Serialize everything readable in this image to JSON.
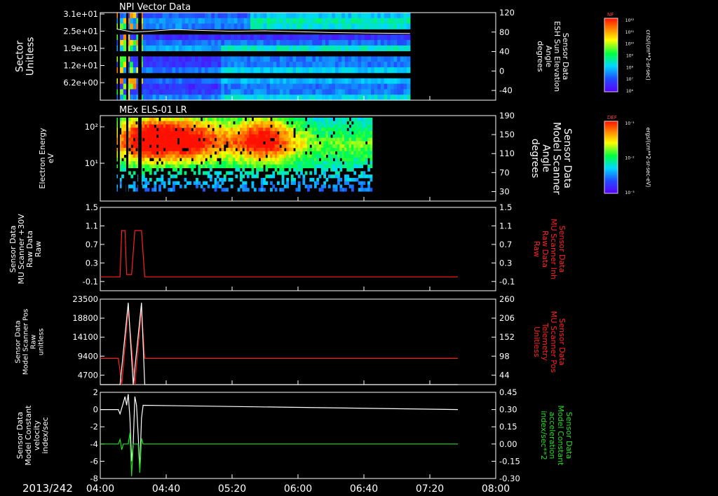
{
  "date_label": "2013/242",
  "time_ticks": [
    "04:00",
    "04:40",
    "05:20",
    "06:00",
    "06:40",
    "07:20",
    "08:00"
  ],
  "colors": {
    "background": "#000000",
    "axis": "#ffffff",
    "trace_red": "#ff2020",
    "trace_green": "#22dd22",
    "trace_white": "#ffffff",
    "right_label_red": "#ff2020",
    "right_label_green": "#22dd22"
  },
  "chart_data": [
    {
      "type": "heatmap",
      "title": "NPI Vector Data",
      "x_range": [
        "04:00",
        "08:00"
      ],
      "y_label_lines": [
        "Sector",
        "Unitless"
      ],
      "y_ticks": [
        "3.1e+01",
        "2.5e+01",
        "1.9e+01",
        "1.2e+01",
        "6.2e+00"
      ],
      "right_ticks": [
        "120",
        "80",
        "40",
        "0",
        "-40"
      ],
      "right_range": [
        -80,
        120
      ],
      "right_label_lines": [
        "Sensor Data",
        "ESH Sun Elevation",
        "Angle",
        "degrees"
      ],
      "colorbar": {
        "label": "NF",
        "units": "cnts/(cm**2-sr-sec)",
        "ticks": [
          "10¹²",
          "10¹¹",
          "10¹⁰",
          "10⁹",
          "10⁸",
          "10⁷",
          "10⁶"
        ]
      },
      "data_extent": [
        "04:10",
        "07:08"
      ],
      "overlay_line": {
        "name": "ESH Sun Elevation Angle",
        "x": [
          "04:10",
          "04:20",
          "04:30",
          "04:45",
          "05:00",
          "05:20",
          "05:40",
          "06:00",
          "06:20",
          "06:40",
          "07:08"
        ],
        "y": [
          85,
          78,
          80,
          84,
          82,
          80,
          81,
          79,
          77,
          76,
          75
        ]
      }
    },
    {
      "type": "heatmap",
      "title": "MEx ELS-01 LR",
      "x_range": [
        "04:00",
        "08:00"
      ],
      "y_label_lines": [
        "Electron Energy",
        "eV"
      ],
      "y_ticks": [
        "10²",
        "10¹"
      ],
      "y_scale": "log",
      "right_ticks": [
        "190",
        "150",
        "110",
        "70",
        "30"
      ],
      "right_range": [
        0,
        190
      ],
      "right_label_lines": [
        "Sensor Data",
        "Model Scanner",
        "Angle",
        "degrees"
      ],
      "colorbar": {
        "label": "DEF",
        "units": "ergs/(cm**2-sr-sec-eV)",
        "ticks": [
          "10⁻¹",
          "10⁻²",
          "10⁻³"
        ]
      },
      "data_extent": [
        "04:10",
        "06:45"
      ]
    },
    {
      "type": "line",
      "x_range": [
        "04:00",
        "08:00"
      ],
      "y_label_lines": [
        "Sensor Data",
        "MU Scanner +30V",
        "Raw Data",
        "Raw"
      ],
      "y_ticks": [
        "1.5",
        "1.1",
        "0.7",
        "0.3",
        "-0.1"
      ],
      "ylim": [
        -0.3,
        1.5
      ],
      "right_ticks": [
        "1.5",
        "1.1",
        "0.7",
        "0.3",
        "-0.1"
      ],
      "right_label_lines": [
        "Sensor Data",
        "MU Scanner Inh",
        "Raw Data",
        "Raw"
      ],
      "series": [
        {
          "name": "MU Scanner Inh",
          "color": "red",
          "x": [
            "04:00",
            "04:12",
            "04:13",
            "04:15",
            "04:16",
            "04:19",
            "04:21",
            "04:22",
            "04:25",
            "04:27",
            "07:37"
          ],
          "y": [
            0,
            0,
            1.0,
            1.0,
            0.05,
            0.05,
            1.0,
            1.0,
            1.0,
            0,
            0
          ]
        }
      ]
    },
    {
      "type": "line",
      "x_range": [
        "04:00",
        "08:00"
      ],
      "y_label_lines": [
        "Sensor Data",
        "Model Scanner Pos",
        "Raw",
        "unitless"
      ],
      "y_ticks": [
        "23500",
        "18800",
        "14100",
        "9400",
        "4700"
      ],
      "ylim": [
        0,
        23500
      ],
      "right_ticks": [
        "260",
        "206",
        "152",
        "98",
        "44"
      ],
      "right_range": [
        0,
        260
      ],
      "right_label_lines": [
        "Sensor Data",
        "MU Scanner Pos",
        "Telemetry",
        "Unitless"
      ],
      "series": [
        {
          "name": "MU Scanner Pos Telemetry",
          "color": "red",
          "axis": "right",
          "x": [
            "04:00",
            "04:11",
            "04:13",
            "04:17",
            "04:21",
            "04:25",
            "04:27",
            "07:37"
          ],
          "y": [
            80,
            80,
            0,
            230,
            0,
            230,
            80,
            80
          ]
        },
        {
          "name": "Model Scanner Pos",
          "color": "white",
          "x": [
            "04:00",
            "04:12",
            "04:17",
            "04:20",
            "04:25",
            "04:27",
            "07:37"
          ],
          "y": [
            0,
            0,
            22500,
            0,
            22500,
            0,
            0
          ]
        }
      ]
    },
    {
      "type": "line",
      "x_range": [
        "04:00",
        "08:00"
      ],
      "y_label_lines": [
        "Sensor Data",
        "Model Constant",
        "velocity",
        "index/sec"
      ],
      "y_ticks": [
        "2",
        "0",
        "-2",
        "-4",
        "-6",
        "-8"
      ],
      "ylim": [
        -8,
        2
      ],
      "right_ticks": [
        "0.45",
        "0.30",
        "0.15",
        "0.00",
        "-0.15",
        "-0.30"
      ],
      "right_range": [
        -0.3,
        0.45
      ],
      "right_label_lines": [
        "Sensor Data",
        "Model Constant",
        "acceleration",
        "index/sec**2"
      ],
      "series": [
        {
          "name": "Model Constant velocity",
          "color": "white",
          "x": [
            "04:00",
            "04:11",
            "04:12",
            "04:14",
            "04:15",
            "04:16",
            "04:17",
            "04:18",
            "04:19",
            "04:20",
            "04:21",
            "04:22",
            "04:23",
            "04:24",
            "04:25",
            "04:26",
            "07:37"
          ],
          "y": [
            0,
            0,
            -0.5,
            0.8,
            1.5,
            0.5,
            1.8,
            -1,
            -6,
            -4,
            1.5,
            0.5,
            -3,
            -7,
            -1,
            0.5,
            0
          ]
        },
        {
          "name": "Model Constant acceleration",
          "color": "green",
          "axis": "right",
          "x": [
            "04:00",
            "04:11",
            "04:12",
            "04:13",
            "04:14",
            "04:17",
            "04:18",
            "04:19",
            "04:20",
            "04:23",
            "04:24",
            "04:25",
            "04:26",
            "07:37"
          ],
          "y": [
            0,
            0,
            0.04,
            -0.05,
            0,
            0,
            0.1,
            -0.28,
            0,
            0,
            -0.25,
            0.05,
            0,
            0
          ]
        }
      ]
    }
  ]
}
